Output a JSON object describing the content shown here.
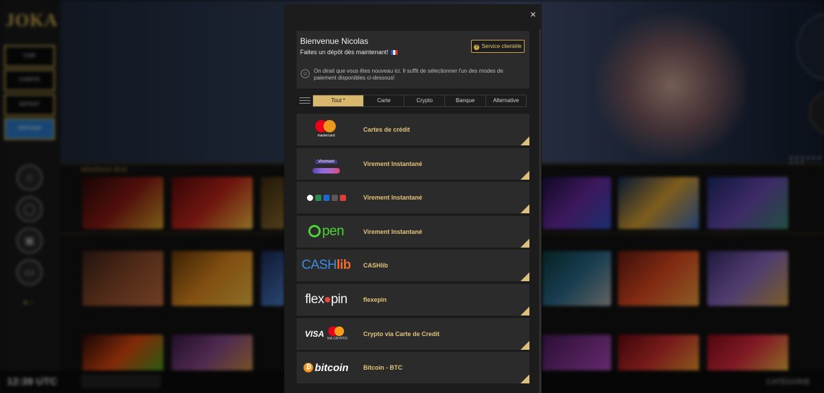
{
  "sidebar": {
    "logo": "JOKA",
    "buttons": [
      "CGBI",
      "COMPTE",
      "RETRAIT",
      "DÉPOSER"
    ]
  },
  "bottom_bar": {
    "time": "12:39 UTC",
    "category": "CATÉGORIE"
  },
  "modal": {
    "close_label": "×",
    "welcome_title": "Bienvenue Nicolas",
    "welcome_subtitle": "Faites un dépôt dès maintenant!",
    "service_button": "Service clientèle",
    "note": "On dirait que vous êtes nouveau ici. Il suffit de sélectionner l'un des modes de paiement disponibles ci-dessous!",
    "tabs": [
      "Tout *",
      "Carte",
      "Crypto",
      "Banque",
      "Alternative"
    ],
    "active_tab": 0,
    "methods": [
      {
        "name": "Cartes de crédit",
        "logo": "mastercard-icon",
        "logo_text": "mastercard"
      },
      {
        "name": "Virement Instantané",
        "logo": "virement-icon",
        "logo_text": "Virement"
      },
      {
        "name": "Virement Instantané",
        "logo": "bank-apps-icon",
        "logo_text": ""
      },
      {
        "name": "Virement Instantané",
        "logo": "open-icon",
        "logo_text": "pen"
      },
      {
        "name": "CASHlib",
        "logo": "cashlib-icon",
        "logo_text": "CASH"
      },
      {
        "name": "flexepin",
        "logo": "flexepin-icon",
        "logo_text": "flex"
      },
      {
        "name": "Crypto via Carte de Credit",
        "logo": "visa-mastercard-icon",
        "logo_text": "VISA"
      },
      {
        "name": "Bitcoin - BTC",
        "logo": "bitcoin-icon",
        "logo_text": "bitcoin"
      }
    ]
  },
  "colors": {
    "accent_gold": "#d7b86c",
    "modal_bg": "#1c1c1c",
    "row_bg": "#2b2b2b"
  }
}
